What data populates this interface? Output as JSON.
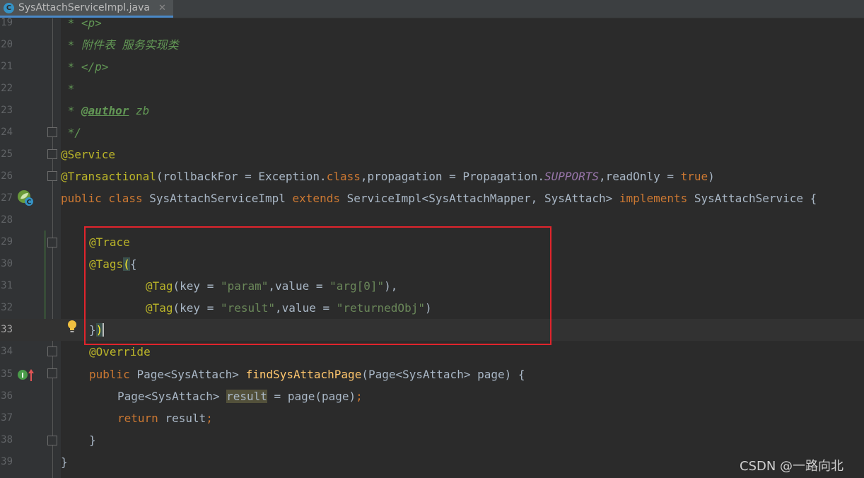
{
  "tab": {
    "title": "SysAttachServiceImpl.java",
    "icon_letter": "C",
    "close_glyph": "✕"
  },
  "watermark": "CSDN @一路向北⁠",
  "lines": [
    {
      "num": "19"
    },
    {
      "num": "20"
    },
    {
      "num": "21"
    },
    {
      "num": "22"
    },
    {
      "num": "23"
    },
    {
      "num": "24"
    },
    {
      "num": "25"
    },
    {
      "num": "26"
    },
    {
      "num": "27"
    },
    {
      "num": "28"
    },
    {
      "num": "29"
    },
    {
      "num": "30"
    },
    {
      "num": "31"
    },
    {
      "num": "32"
    },
    {
      "num": "33"
    },
    {
      "num": "34"
    },
    {
      "num": "35"
    },
    {
      "num": "36"
    },
    {
      "num": "37"
    },
    {
      "num": "38"
    },
    {
      "num": "39"
    }
  ],
  "code": {
    "l19": " * <p>",
    "l20": " * 附件表 服务实现类",
    "l21": " * </p>",
    "l22": " *",
    "l23a": " * ",
    "l23tag": "@author",
    "l23b": " zb",
    "l24": " */",
    "l25": "@Service",
    "l26": {
      "ann": "@Transactional",
      "p1": "(rollbackFor = Exception.",
      "kw": "class",
      "p2": ",propagation = Propagation.",
      "st": "SUPPORTS",
      "p3": ",readOnly = ",
      "kw2": "true",
      "p4": ")"
    },
    "l27": {
      "kw1": "public class ",
      "name": "SysAttachServiceImpl ",
      "kw2": "extends ",
      "mid": "ServiceImpl<SysAttachMapper, SysAttach> ",
      "kw3": "implements ",
      "end": "SysAttachService {"
    },
    "l29": "@Trace",
    "l30": {
      "ann": "@Tags",
      "br": "(",
      "rest": "{"
    },
    "l31": {
      "ann": "@Tag",
      "p1": "(key = ",
      "s1": "\"param\"",
      "p2": ",value = ",
      "s2": "\"arg[0]\"",
      "p3": "),"
    },
    "l32": {
      "ann": "@Tag",
      "p1": "(key = ",
      "s1": "\"result\"",
      "p2": ",value = ",
      "s2": "\"returnedObj\"",
      "p3": ")"
    },
    "l33": {
      "a": "}",
      "br": ")"
    },
    "l34": "@Override",
    "l35": {
      "kw": "public ",
      "t": "Page<SysAttach> ",
      "m": "findSysAttachPage",
      "rest": "(Page<SysAttach> page) {"
    },
    "l36": {
      "t": "Page<SysAttach> ",
      "v": "result",
      "rest": " = page(page)",
      "semi": ";"
    },
    "l37": {
      "kw": "return ",
      "v": "result",
      "semi": ";"
    },
    "l38": "}",
    "l39": "}"
  },
  "colors": {
    "accent": "#e1242c",
    "keyword": "#cc7832",
    "annotation": "#bbb529",
    "string": "#6a8759",
    "doc": "#629755"
  }
}
